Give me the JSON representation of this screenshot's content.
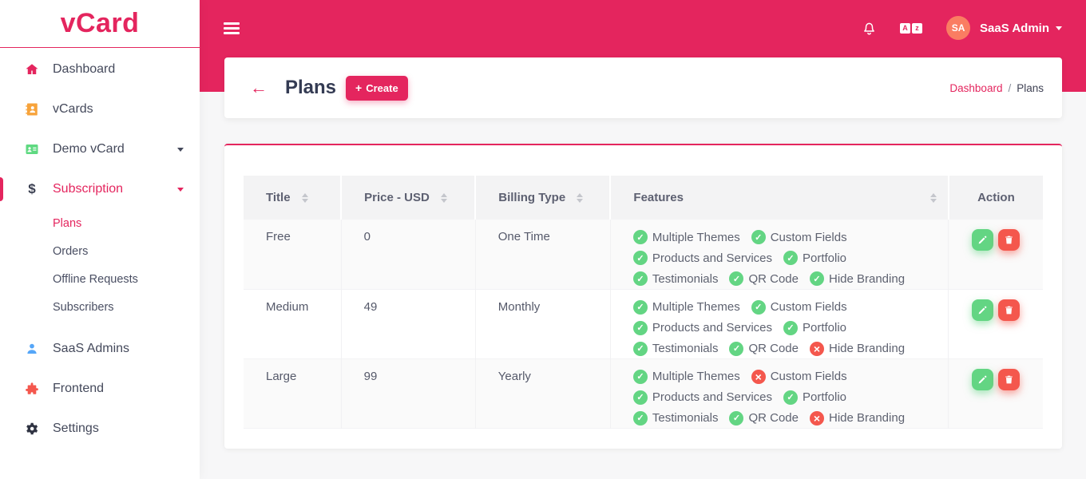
{
  "app": {
    "logo_text": "vCard"
  },
  "colors": {
    "primary": "#e4255e",
    "green": "#63d583",
    "red": "#f4574d",
    "avatar_bg": "#fa7d62"
  },
  "sidebar": {
    "items": [
      {
        "id": "dashboard",
        "label": "Dashboard",
        "icon": "home-icon",
        "icon_color": "#e4255e",
        "caret": false,
        "active": false
      },
      {
        "id": "vcards",
        "label": "vCards",
        "icon": "address-book-icon",
        "icon_color": "#f7a33b",
        "caret": false,
        "active": false
      },
      {
        "id": "demo-vcard",
        "label": "Demo vCard",
        "icon": "id-card-icon",
        "icon_color": "#5fd981",
        "caret": true,
        "active": false
      },
      {
        "id": "subscription",
        "label": "Subscription",
        "icon": "dollar-icon",
        "icon_color": "#3a3f51",
        "caret": true,
        "active": true,
        "children": [
          {
            "id": "plans",
            "label": "Plans",
            "active": true
          },
          {
            "id": "orders",
            "label": "Orders",
            "active": false
          },
          {
            "id": "offline-requests",
            "label": "Offline Requests",
            "active": false
          },
          {
            "id": "subscribers",
            "label": "Subscribers",
            "active": false
          }
        ]
      },
      {
        "id": "saas-admins",
        "label": "SaaS Admins",
        "icon": "user-icon",
        "icon_color": "#55a6f8",
        "caret": false,
        "active": false
      },
      {
        "id": "frontend",
        "label": "Frontend",
        "icon": "puzzle-icon",
        "icon_color": "#f4574d",
        "caret": false,
        "active": false
      },
      {
        "id": "settings",
        "label": "Settings",
        "icon": "gear-icon",
        "icon_color": "#2f3342",
        "caret": false,
        "active": false
      }
    ]
  },
  "navbar": {
    "language_icon": {
      "left": "A",
      "right": "z"
    },
    "user": {
      "initials": "SA",
      "name": "SaaS Admin"
    }
  },
  "page_header": {
    "back_icon": "←",
    "title": "Plans",
    "create_button": {
      "plus": "+",
      "label": "Create"
    },
    "breadcrumb": {
      "link": "Dashboard",
      "separator": "/",
      "current": "Plans"
    }
  },
  "table": {
    "columns": [
      {
        "label": "Title",
        "sortable": true
      },
      {
        "label": "Price - USD",
        "sortable": true
      },
      {
        "label": "Billing Type",
        "sortable": true
      },
      {
        "label": "Features",
        "sortable": true
      },
      {
        "label": "Action",
        "sortable": false
      }
    ],
    "feature_icons": {
      "check": "✓",
      "cross": "×"
    },
    "rows": [
      {
        "title": "Free",
        "price": "0",
        "billing_type": "One Time",
        "features": [
          {
            "label": "Multiple Themes",
            "enabled": true
          },
          {
            "label": "Custom Fields",
            "enabled": true
          },
          {
            "label": "Products and Services",
            "enabled": true
          },
          {
            "label": "Portfolio",
            "enabled": true
          },
          {
            "label": "Testimonials",
            "enabled": true
          },
          {
            "label": "QR Code",
            "enabled": true
          },
          {
            "label": "Hide Branding",
            "enabled": true
          }
        ]
      },
      {
        "title": "Medium",
        "price": "49",
        "billing_type": "Monthly",
        "features": [
          {
            "label": "Multiple Themes",
            "enabled": true
          },
          {
            "label": "Custom Fields",
            "enabled": true
          },
          {
            "label": "Products and Services",
            "enabled": true
          },
          {
            "label": "Portfolio",
            "enabled": true
          },
          {
            "label": "Testimonials",
            "enabled": true
          },
          {
            "label": "QR Code",
            "enabled": true
          },
          {
            "label": "Hide Branding",
            "enabled": false
          }
        ]
      },
      {
        "title": "Large",
        "price": "99",
        "billing_type": "Yearly",
        "features": [
          {
            "label": "Multiple Themes",
            "enabled": true
          },
          {
            "label": "Custom Fields",
            "enabled": false
          },
          {
            "label": "Products and Services",
            "enabled": true
          },
          {
            "label": "Portfolio",
            "enabled": true
          },
          {
            "label": "Testimonials",
            "enabled": true
          },
          {
            "label": "QR Code",
            "enabled": true
          },
          {
            "label": "Hide Branding",
            "enabled": false
          }
        ]
      }
    ]
  }
}
